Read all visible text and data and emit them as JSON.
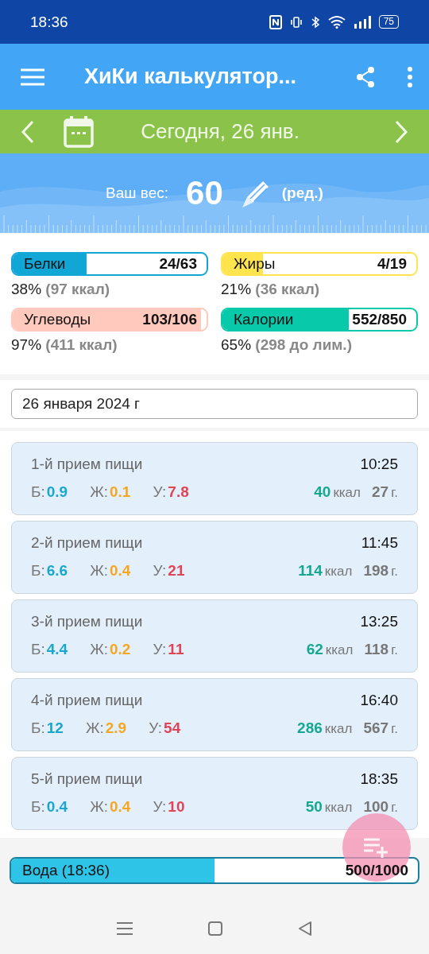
{
  "status_bar": {
    "time": "18:36",
    "battery": "75"
  },
  "app_bar": {
    "title": "ХиКи калькулятор..."
  },
  "date_bar": {
    "label": "Сегодня, 26 янв."
  },
  "weight": {
    "label": "Ваш вес:",
    "value": "60",
    "edit": "(ред.)"
  },
  "macros": [
    {
      "name": "Белки",
      "amount": "24/63",
      "level": 0.38,
      "color": "#1ba3cf",
      "percent": "38%",
      "note": "(97 ккал)"
    },
    {
      "name": "Жиры",
      "amount": "4/19",
      "level": 0.21,
      "color": "#ffe45a",
      "percent": "21%",
      "note": "(36 ккал)"
    },
    {
      "name": "Углеводы",
      "amount": "103/106",
      "level": 0.97,
      "color": "#ffcbbf",
      "percent": "97%",
      "note": "(411 ккал)"
    },
    {
      "name": "Калории",
      "amount": "552/850",
      "level": 0.65,
      "color": "#16c5a8",
      "percent": "65%",
      "note": "(298 до лим.)"
    }
  ],
  "date_field": {
    "value": "26 января 2024 г"
  },
  "meals": [
    {
      "title": "1-й прием пищи",
      "time": "10:25",
      "protein": {
        "label": "Б:",
        "value": "0.9"
      },
      "fat": {
        "label": "Ж:",
        "value": "0.1"
      },
      "carbs": {
        "label": "У:",
        "value": "7.8"
      },
      "energy": {
        "value": "40",
        "unit": "ккал"
      },
      "weight": {
        "value": "27",
        "unit": "г."
      }
    },
    {
      "title": "2-й прием пищи",
      "time": "11:45",
      "protein": {
        "label": "Б:",
        "value": "6.6"
      },
      "fat": {
        "label": "Ж:",
        "value": "0.4"
      },
      "carbs": {
        "label": "У:",
        "value": "21"
      },
      "energy": {
        "value": "114",
        "unit": "ккал"
      },
      "weight": {
        "value": "198",
        "unit": "г."
      }
    },
    {
      "title": "3-й прием пищи",
      "time": "13:25",
      "protein": {
        "label": "Б:",
        "value": "4.4"
      },
      "fat": {
        "label": "Ж:",
        "value": "0.2"
      },
      "carbs": {
        "label": "У:",
        "value": "11"
      },
      "energy": {
        "value": "62",
        "unit": "ккал"
      },
      "weight": {
        "value": "118",
        "unit": "г."
      }
    },
    {
      "title": "4-й прием пищи",
      "time": "16:40",
      "protein": {
        "label": "Б:",
        "value": "12"
      },
      "fat": {
        "label": "Ж:",
        "value": "2.9"
      },
      "carbs": {
        "label": "У:",
        "value": "54"
      },
      "energy": {
        "value": "286",
        "unit": "ккал"
      },
      "weight": {
        "value": "567",
        "unit": "г."
      }
    },
    {
      "title": "5-й прием пищи",
      "time": "18:35",
      "protein": {
        "label": "Б:",
        "value": "0.4"
      },
      "fat": {
        "label": "Ж:",
        "value": "0.4"
      },
      "carbs": {
        "label": "У:",
        "value": "10"
      },
      "energy": {
        "value": "50",
        "unit": "ккал"
      },
      "weight": {
        "value": "100",
        "unit": "г."
      }
    }
  ],
  "water": {
    "label": "Вода (18:36)",
    "amount": "500/1000",
    "level": 0.5
  }
}
